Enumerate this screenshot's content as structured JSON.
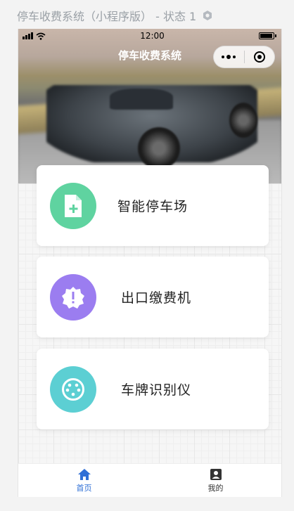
{
  "frame": {
    "title": "停车收费系统（小程序版） - 状态 1",
    "icon": "gear-icon"
  },
  "status_bar": {
    "time": "12:00"
  },
  "nav": {
    "title": "停车收费系统"
  },
  "colors": {
    "green": "#5fd3a0",
    "purple": "#9b7df0",
    "teal": "#5ccfd3",
    "tab_active": "#2f6fd6",
    "tab_inactive": "#333333"
  },
  "cards": [
    {
      "label": "智能停车场",
      "icon": "file-plus-icon"
    },
    {
      "label": "出口缴费机",
      "icon": "alert-badge-icon"
    },
    {
      "label": "车牌识别仪",
      "icon": "socket-icon"
    }
  ],
  "tabbar": {
    "items": [
      {
        "label": "首页",
        "icon": "home-icon",
        "active": true
      },
      {
        "label": "我的",
        "icon": "user-card-icon",
        "active": false
      }
    ]
  }
}
